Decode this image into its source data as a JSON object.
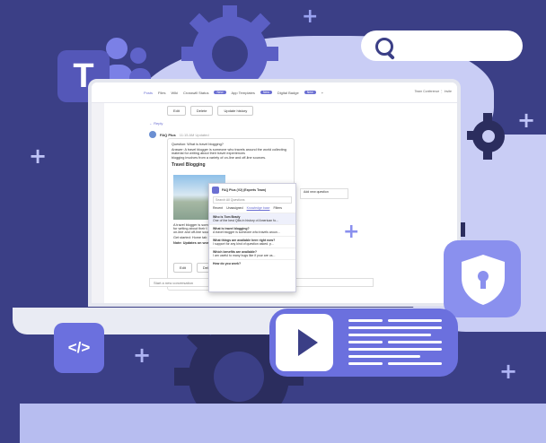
{
  "hero": {
    "search": {
      "placeholder": ""
    },
    "teams_letter": "T",
    "code_label": "</>",
    "colors": {
      "background": "#3b3f86",
      "accent": "#6b70de",
      "light": "#c9cdf5"
    }
  },
  "teams_ui": {
    "tabs": [
      "Posts",
      "Files",
      "Wiki",
      "Crosswill Status",
      "App Templates",
      "Digital Badge"
    ],
    "right": "Team  Conference  ⋮  Invite",
    "top_buttons": [
      "Edit",
      "Delete",
      "Update history"
    ],
    "reply": "← Reply",
    "bot": {
      "name": "FAQ Plus",
      "meta": "11:15 AM  Updated"
    },
    "question": "Question: What is travel blogging?",
    "answer": "Answer: A travel blogger is someone who travels around the world collecting material for writing about their travel experiences",
    "answer_more": "blogging involves from a variety of on-line and off-line sources.",
    "card_title": "Travel Blogging",
    "card_text_1": "A travel blogger is someone",
    "card_text_2": "for writing about their t",
    "card_text_3": "on-line and off-line sources.",
    "card_link": "Get started: Home tab",
    "card_note": "Note: Updates on workst",
    "card_buttons": [
      "Edit",
      "Delete"
    ],
    "compose_placeholder": "Start a new conversation",
    "panel": {
      "header": "FAQ Plus (V2) (Experts Team)",
      "search_placeholder": "Search All Questions",
      "filters": [
        "Recent",
        "Unassigned",
        "Knowledge base",
        "Filters"
      ],
      "items": [
        {
          "title": "Who is Tom Brady",
          "sub": "One of the best QBs in history of American fo..."
        },
        {
          "title": "What is travel blogging?",
          "sub": "A travel blogger is someone who travels aroun..."
        },
        {
          "title": "What things are available here right now?",
          "sub": "I support for any kind of question asked. p..."
        },
        {
          "title": "Which benefits are available?",
          "sub": "I am useful to many bugs like if your are us..."
        },
        {
          "title": "How do you work?",
          "sub": ""
        }
      ]
    },
    "tooltip": "Add new question"
  }
}
